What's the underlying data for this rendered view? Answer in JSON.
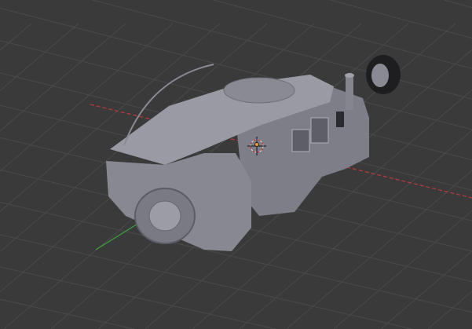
{
  "viewport": {
    "background": "#3a3a3a",
    "grid_color": "#4a4a4a",
    "x_axis_color": "#b33a3a",
    "y_axis_color": "#3a9a3a",
    "model_color": "#8c8c96"
  },
  "scene": {
    "object": "humvee-model",
    "cursor_icon": "3d-cursor-icon",
    "origin_icon": "object-origin-icon"
  }
}
